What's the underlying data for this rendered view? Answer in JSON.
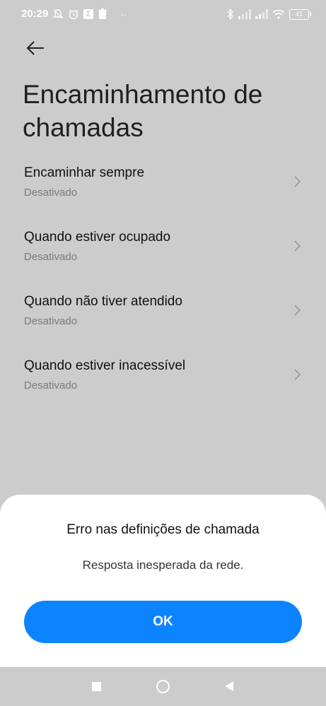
{
  "status_bar": {
    "time": "20:29",
    "battery": "41",
    "icons_left": [
      "mute-icon",
      "alarm-icon",
      "sigma-icon",
      "trash-icon",
      "more-dots-icon"
    ],
    "icons_right": [
      "bluetooth-icon",
      "signal-icon",
      "signal-icon",
      "wifi-icon",
      "battery-icon"
    ],
    "sigma_glyph": "Σ",
    "dots": "··"
  },
  "header": {
    "title": "Encaminhamento de chamadas"
  },
  "forwarding_options": [
    {
      "label": "Encaminhar sempre",
      "status": "Desativado"
    },
    {
      "label": "Quando estiver ocupado",
      "status": "Desativado"
    },
    {
      "label": "Quando não tiver atendido",
      "status": "Desativado"
    },
    {
      "label": "Quando estiver inacessível",
      "status": "Desativado"
    }
  ],
  "dialog": {
    "title": "Erro nas definições de chamada",
    "message": "Resposta inesperada da rede.",
    "ok_label": "OK"
  },
  "colors": {
    "background": "#cccccc",
    "dialog_bg": "#ffffff",
    "accent": "#0d84ff"
  }
}
